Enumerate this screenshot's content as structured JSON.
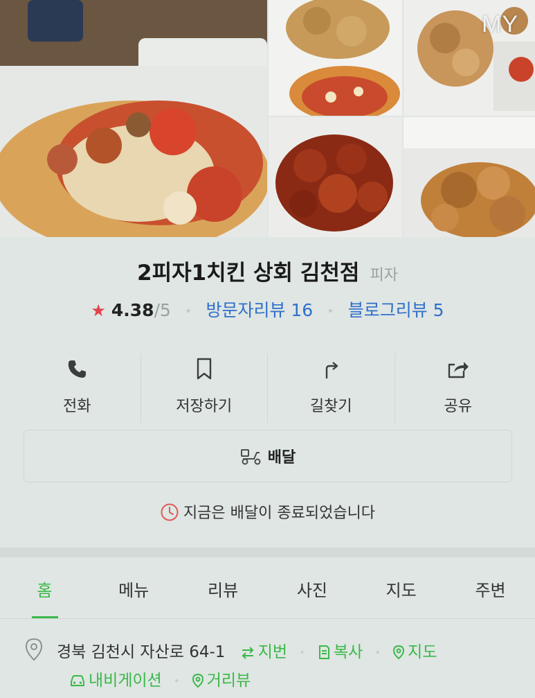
{
  "gallery": {
    "badge": "MY",
    "photos": [
      "pizza-closeup-photo",
      "fried-chicken-and-pizza-photo",
      "fried-chicken-box-photo",
      "seasoned-chicken-photo",
      "crispy-chicken-photo"
    ]
  },
  "place": {
    "name": "2피자1치킨 상회 김천점",
    "category": "피자"
  },
  "rating": {
    "star": "★",
    "score": "4.38",
    "max": "/5",
    "visitor_reviews": "방문자리뷰 16",
    "blog_reviews": "블로그리뷰 5"
  },
  "actions": {
    "call": "전화",
    "save": "저장하기",
    "directions": "길찾기",
    "share": "공유"
  },
  "delivery": {
    "label": "배달",
    "notice": "지금은 배달이 종료되었습니다"
  },
  "tabs": [
    "홈",
    "메뉴",
    "리뷰",
    "사진",
    "지도",
    "주변"
  ],
  "active_tab": "홈",
  "address": {
    "text": "경북 김천시 자산로 64-1",
    "jibun": "지번",
    "copy": "복사",
    "map": "지도",
    "navigation": "내비게이션",
    "street_view": "거리뷰"
  },
  "colors": {
    "accent_green": "#3bb84a",
    "link_blue": "#2f6fca",
    "star_red": "#e3424b",
    "background": "#dfe6e3"
  }
}
